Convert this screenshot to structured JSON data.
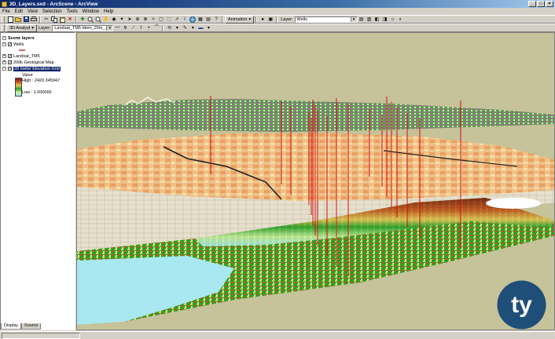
{
  "window": {
    "title": "3D_Layers.sxd - ArcScene - ArcView",
    "minimize": "_",
    "maximize": "□",
    "close": "×"
  },
  "menu": [
    "File",
    "Edit",
    "View",
    "Selection",
    "Tools",
    "Window",
    "Help"
  ],
  "toolbar": {
    "animation_label": "Animation",
    "layer_label": "Layer:",
    "layer_value": "Wells"
  },
  "analyst_bar": {
    "button_label": "3D Analyst",
    "layer_label": "Layer:",
    "layer_value": "Landsat_TM5 tdem_20m_..."
  },
  "toc": {
    "root": "Scene layers",
    "layers": [
      {
        "name": "Wells",
        "checked": true
      },
      {
        "name": "Landsat_TM5",
        "checked": true
      },
      {
        "name": "200k Geological Map",
        "checked": true
      },
      {
        "name": "20 meter Elevation Grid",
        "checked": true,
        "selected": true
      }
    ],
    "legend": {
      "heading": "Value",
      "high": "High : 2420.345947",
      "low": "Low : 1.000066",
      "ramp_colors": [
        "#7a1a10",
        "#c8501e",
        "#e8c85a",
        "#2aa02a",
        "#c8f0a0",
        "#a8e8f0"
      ]
    }
  },
  "tabs": [
    "Display",
    "Source"
  ],
  "logo_text": "ty",
  "colors": {
    "titlebar": "#0a246a",
    "sky": "#c6c299",
    "selection": "#0a246a",
    "logo": "#1f4e79"
  }
}
